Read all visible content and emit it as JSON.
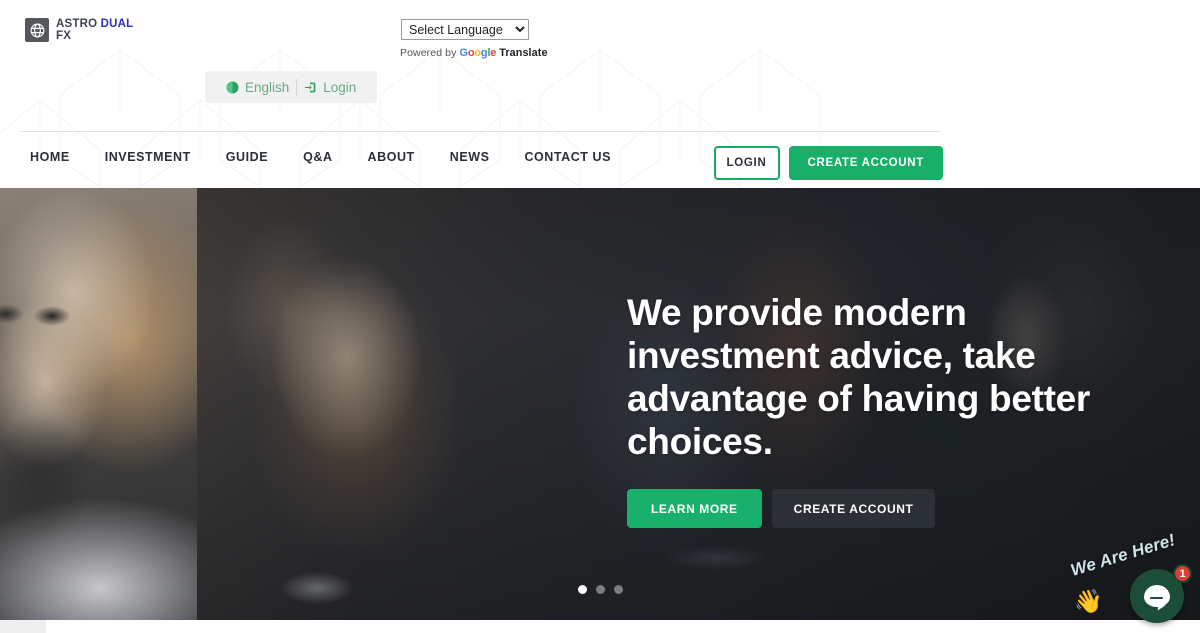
{
  "brand": {
    "logo_icon": "globe-icon",
    "name_part1": "ASTRO",
    "name_part2": "DUAL",
    "name_part3": "FX"
  },
  "translate": {
    "select_value": "Select Language",
    "options": [
      "Select Language"
    ],
    "powered_by": "Powered by",
    "google": "Google",
    "translate_word": "Translate",
    "google_letters": [
      "G",
      "o",
      "o",
      "g",
      "l",
      "e"
    ]
  },
  "quickbar": {
    "language_icon": "globe-icon",
    "language_label": "English",
    "login_icon": "login-arrow-icon",
    "login_label": "Login"
  },
  "nav": {
    "items": [
      {
        "label": "HOME"
      },
      {
        "label": "INVESTMENT"
      },
      {
        "label": "GUIDE"
      },
      {
        "label": "Q&A"
      },
      {
        "label": "ABOUT"
      },
      {
        "label": "NEWS"
      },
      {
        "label": "CONTACT US"
      }
    ],
    "login_button": "LOGIN",
    "create_account_button": "CREATE ACCOUNT"
  },
  "hero": {
    "headline": "We provide modern investment advice, take advantage of having better choices.",
    "learn_more_button": "LEARN MORE",
    "create_account_button": "CREATE ACCOUNT",
    "slides": [
      {
        "active": true
      },
      {
        "active": false
      },
      {
        "active": false
      }
    ]
  },
  "chat": {
    "label": "We Are Here!",
    "hand_icon": "waving-hand-icon",
    "bubble_icon": "chat-bubble-icon",
    "badge_count": "1"
  },
  "colors": {
    "brand_green": "#1aaf68",
    "hero_green": "#18b06a",
    "logo_blue": "#2b2fc4",
    "logo_gray": "#3f4550",
    "badge_red": "#e23b35",
    "chat_dark_green": "#1c4d39"
  }
}
